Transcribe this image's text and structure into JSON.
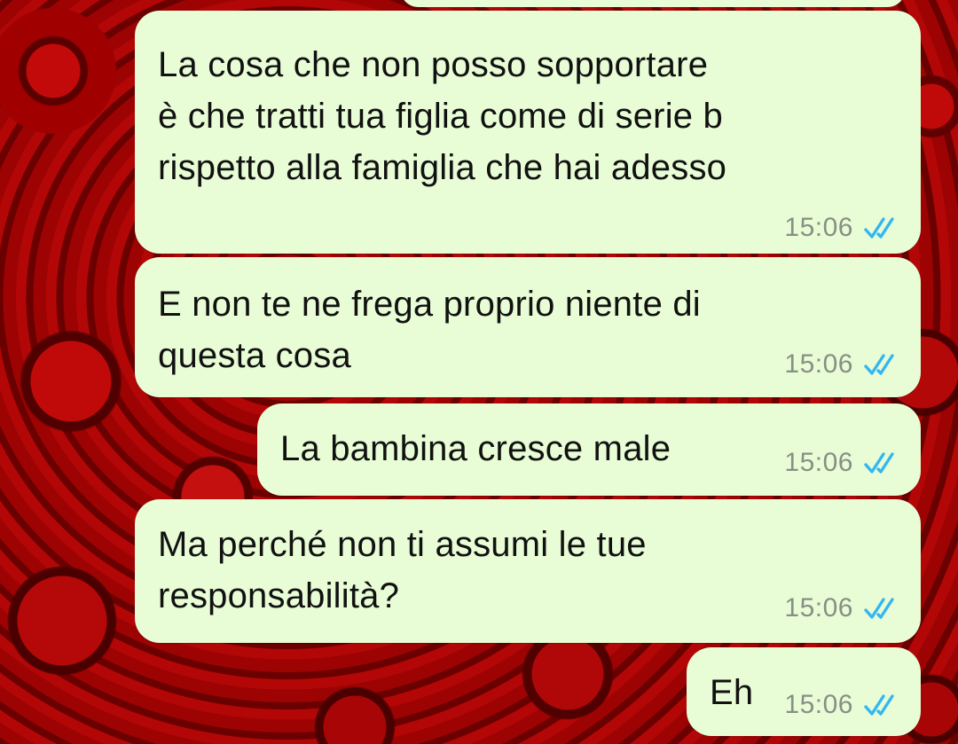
{
  "colors": {
    "bubble_background": "#e8fdd6",
    "text": "#111111",
    "timestamp": "#888f84",
    "read_ticks": "#34b7f1",
    "wallpaper": "#8f0202"
  },
  "wallpaper": {
    "icon": "red-roses-wallpaper"
  },
  "messages": [
    {
      "text": "La cosa che non posso sopportare\nè che tratti tua figlia come di serie b\nrispetto alla famiglia che hai adesso",
      "time": "15:06",
      "status_icon": "double-check-read-icon"
    },
    {
      "text": "E non te ne frega proprio niente di\nquesta cosa",
      "time": "15:06",
      "status_icon": "double-check-read-icon"
    },
    {
      "text": "La bambina cresce male",
      "time": "15:06",
      "status_icon": "double-check-read-icon"
    },
    {
      "text": "Ma perché non ti assumi le tue\nresponsabilità?",
      "time": "15:06",
      "status_icon": "double-check-read-icon"
    },
    {
      "text": "Eh",
      "time": "15:06",
      "status_icon": "double-check-read-icon"
    }
  ]
}
